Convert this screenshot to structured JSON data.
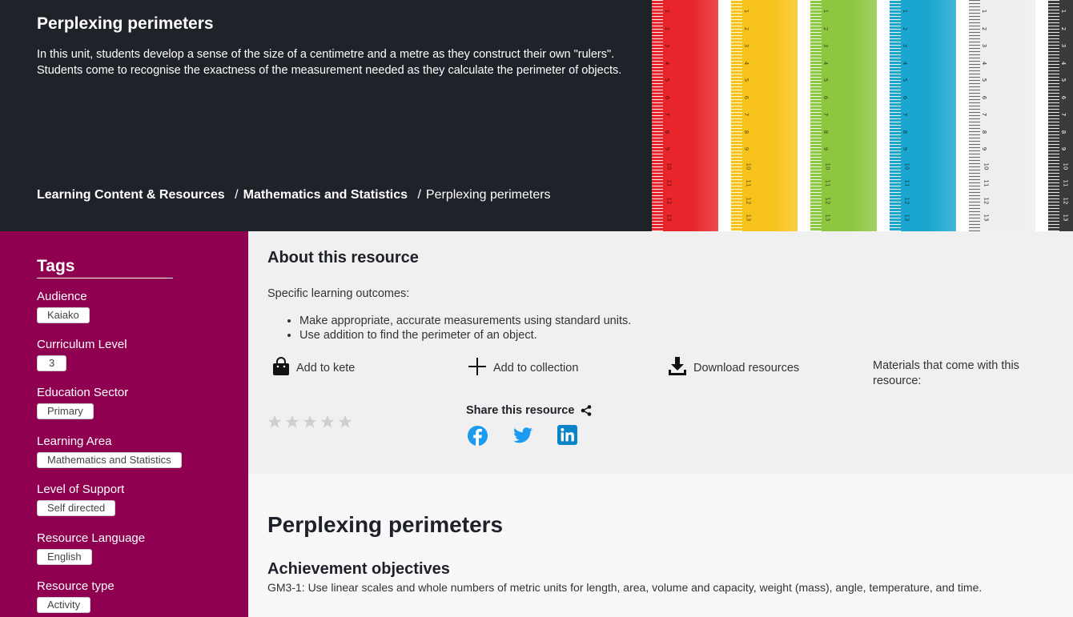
{
  "hero": {
    "title": "Perplexing perimeters",
    "description": "In this unit, students develop a sense of the size of a centimetre and a metre as they construct their own \"rulers\". Students come to recognise the exactness of the measurement needed as they calculate the perimeter of objects.",
    "breadcrumb": [
      "Learning Content & Resources",
      "Mathematics and Statistics",
      "Perplexing perimeters"
    ],
    "ruler_colors": [
      "#e8252a",
      "#f7c31a",
      "#8dc63f",
      "#1ba6d0",
      "#eeeeee",
      "#3a3a3a"
    ],
    "ruler_numbers": [
      "1",
      "2",
      "3",
      "4",
      "5",
      "6",
      "7",
      "8",
      "9",
      "10",
      "11",
      "12",
      "13"
    ]
  },
  "sidebar": {
    "heading": "Tags",
    "groups": [
      {
        "label": "Audience",
        "value": "Kaiako"
      },
      {
        "label": "Curriculum Level",
        "value": "3"
      },
      {
        "label": "Education Sector",
        "value": "Primary"
      },
      {
        "label": "Learning Area",
        "value": "Mathematics and Statistics"
      },
      {
        "label": "Level of Support",
        "value": "Self directed"
      },
      {
        "label": "Resource Language",
        "value": "English"
      },
      {
        "label": "Resource type",
        "value": "Activity"
      }
    ]
  },
  "about": {
    "heading": "About this resource",
    "intro": "Specific learning outcomes:",
    "outcomes": [
      "Make appropriate, accurate measurements using standard units.",
      "Use addition to find the perimeter of an object."
    ],
    "actions": {
      "kete": "Add to kete",
      "collection": "Add to collection",
      "download": "Download resources"
    },
    "materials": "Materials that come with this resource:",
    "share_label": "Share this resource",
    "rating": 0
  },
  "main": {
    "title": "Perplexing perimeters",
    "achievement_heading": "Achievement objectives",
    "achievement_text": "GM3-1: Use linear scales and whole numbers of metric units for length, area, volume and capacity, weight (mass), angle, temperature, and time."
  },
  "colors": {
    "hero_bg": "#1f2229",
    "sidebar_bg": "#900050",
    "about_bg": "#f0f0f0",
    "social_blue": "#1d9bf0"
  }
}
